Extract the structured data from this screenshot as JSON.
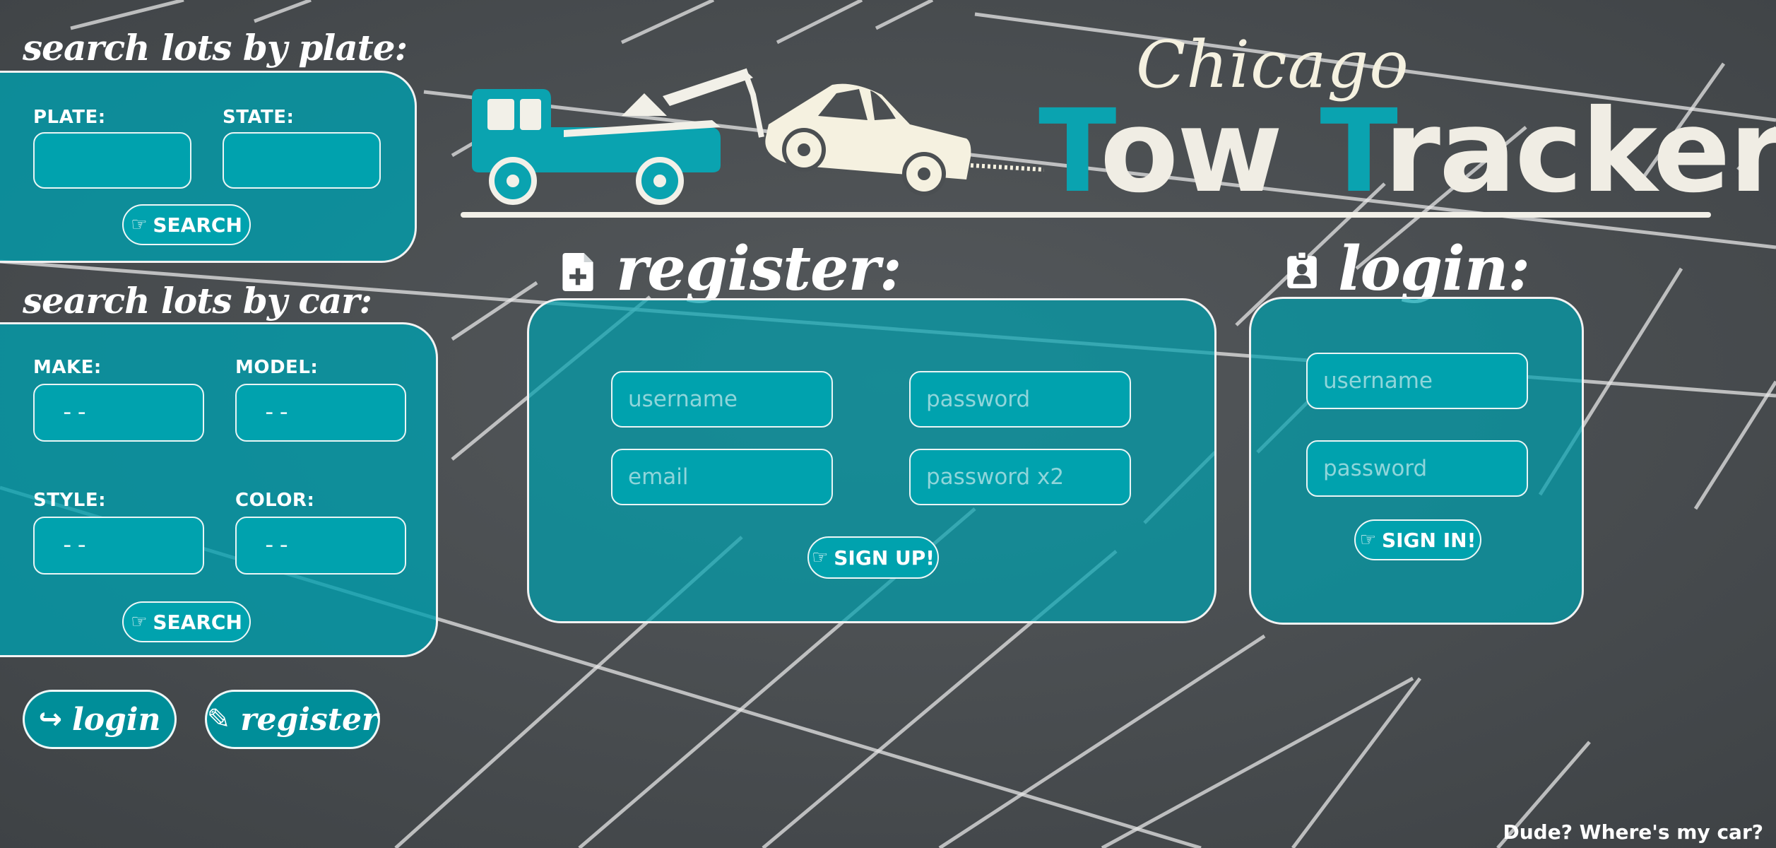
{
  "colors": {
    "accent": "#00a2ae",
    "panel": "#009eac",
    "text": "#ffffff",
    "logo_cream": "#f5f1e0"
  },
  "sidebar": {
    "plate_search": {
      "heading": "search lots by plate:",
      "plate_label": "PLATE:",
      "state_label": "STATE:",
      "plate_value": "",
      "state_value": "",
      "button_icon": "pointing-hand-icon",
      "button_label": "SEARCH"
    },
    "car_search": {
      "heading": "search lots by car:",
      "make_label": "MAKE:",
      "model_label": "MODEL:",
      "style_label": "STYLE:",
      "color_label": "COLOR:",
      "make_value": "--",
      "model_value": "--",
      "style_value": "--",
      "color_value": "--",
      "button_icon": "pointing-hand-icon",
      "button_label": "SEARCH"
    },
    "nav": {
      "login_icon": "share-arrow-icon",
      "login_label": "login",
      "register_icon": "pencil-icon",
      "register_label": "register"
    }
  },
  "logo": {
    "icon": "tow-truck-icon",
    "city": "Chicago",
    "first_letter_1": "T",
    "word_1_rest": "ow",
    "first_letter_2": "T",
    "word_2_rest": "racker"
  },
  "register": {
    "icon": "file-plus-icon",
    "heading": "register:",
    "username_placeholder": "username",
    "password_placeholder": "password",
    "email_placeholder": "email",
    "password2_placeholder": "password x2",
    "button_icon": "pointing-hand-icon",
    "button_label": "SIGN UP!"
  },
  "login": {
    "icon": "id-badge-icon",
    "heading": "login:",
    "username_placeholder": "username",
    "password_placeholder": "password",
    "button_icon": "pointing-hand-icon",
    "button_label": "SIGN IN!"
  },
  "footer": {
    "text": "Dude? Where's my car?"
  }
}
